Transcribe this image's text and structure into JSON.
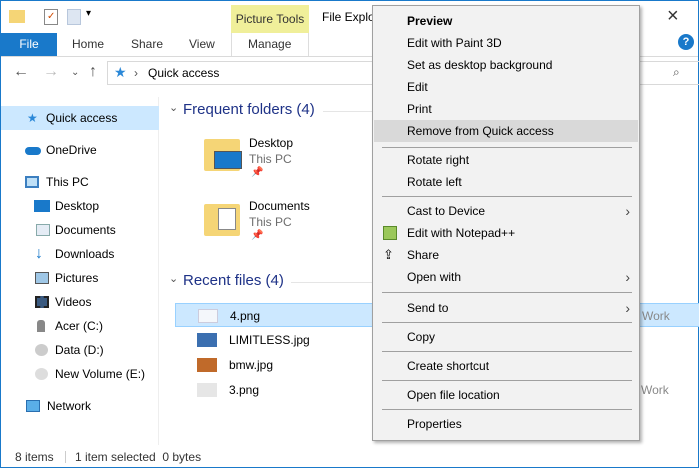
{
  "window": {
    "title": "File Explorer",
    "contextual_tab_group": "Picture Tools",
    "close_icon": "×",
    "help_icon": "?"
  },
  "ribbon": {
    "tabs": [
      "File",
      "Home",
      "Share",
      "View",
      "Manage"
    ]
  },
  "address": {
    "path": "Quick access",
    "sep": "›"
  },
  "sidebar": {
    "items": [
      {
        "label": "Quick access",
        "icon": "star-icon"
      },
      {
        "label": "OneDrive",
        "icon": "cloud-icon"
      },
      {
        "label": "This PC",
        "icon": "computer-icon"
      },
      {
        "label": "Desktop",
        "icon": "desktop-icon"
      },
      {
        "label": "Documents",
        "icon": "documents-icon"
      },
      {
        "label": "Downloads",
        "icon": "download-icon"
      },
      {
        "label": "Pictures",
        "icon": "pictures-icon"
      },
      {
        "label": "Videos",
        "icon": "videos-icon"
      },
      {
        "label": "Acer (C:)",
        "icon": "drive-icon"
      },
      {
        "label": "Data (D:)",
        "icon": "drive-icon"
      },
      {
        "label": "New Volume (E:)",
        "icon": "drive-icon"
      },
      {
        "label": "Network",
        "icon": "network-icon"
      }
    ]
  },
  "frequent": {
    "title": "Frequent folders (4)",
    "folders": [
      {
        "name": "Desktop",
        "location": "This PC"
      },
      {
        "name": "Documents",
        "location": "This PC"
      }
    ]
  },
  "recent": {
    "title": "Recent files (4)",
    "files": [
      {
        "name": "4.png",
        "location": "Work"
      },
      {
        "name": "LIMITLESS.jpg"
      },
      {
        "name": "bmw.jpg"
      },
      {
        "name": "3.png",
        "location": "Work"
      }
    ]
  },
  "status": {
    "count": "8 items",
    "selection": "1 item selected  0 bytes"
  },
  "context_menu": {
    "items": [
      "Preview",
      "Edit with Paint 3D",
      "Set as desktop background",
      "Edit",
      "Print",
      "Remove from Quick access",
      "Rotate right",
      "Rotate left",
      "Cast to Device",
      "Edit with Notepad++",
      "Share",
      "Open with",
      "Send to",
      "Copy",
      "Create shortcut",
      "Open file location",
      "Properties"
    ]
  },
  "colors": {
    "accent": "#1979ca",
    "selection": "#cce8ff",
    "picture_tools": "#f0ef9a",
    "menu_bg": "#f2f2f2",
    "menu_hover": "#d9d9d9"
  }
}
